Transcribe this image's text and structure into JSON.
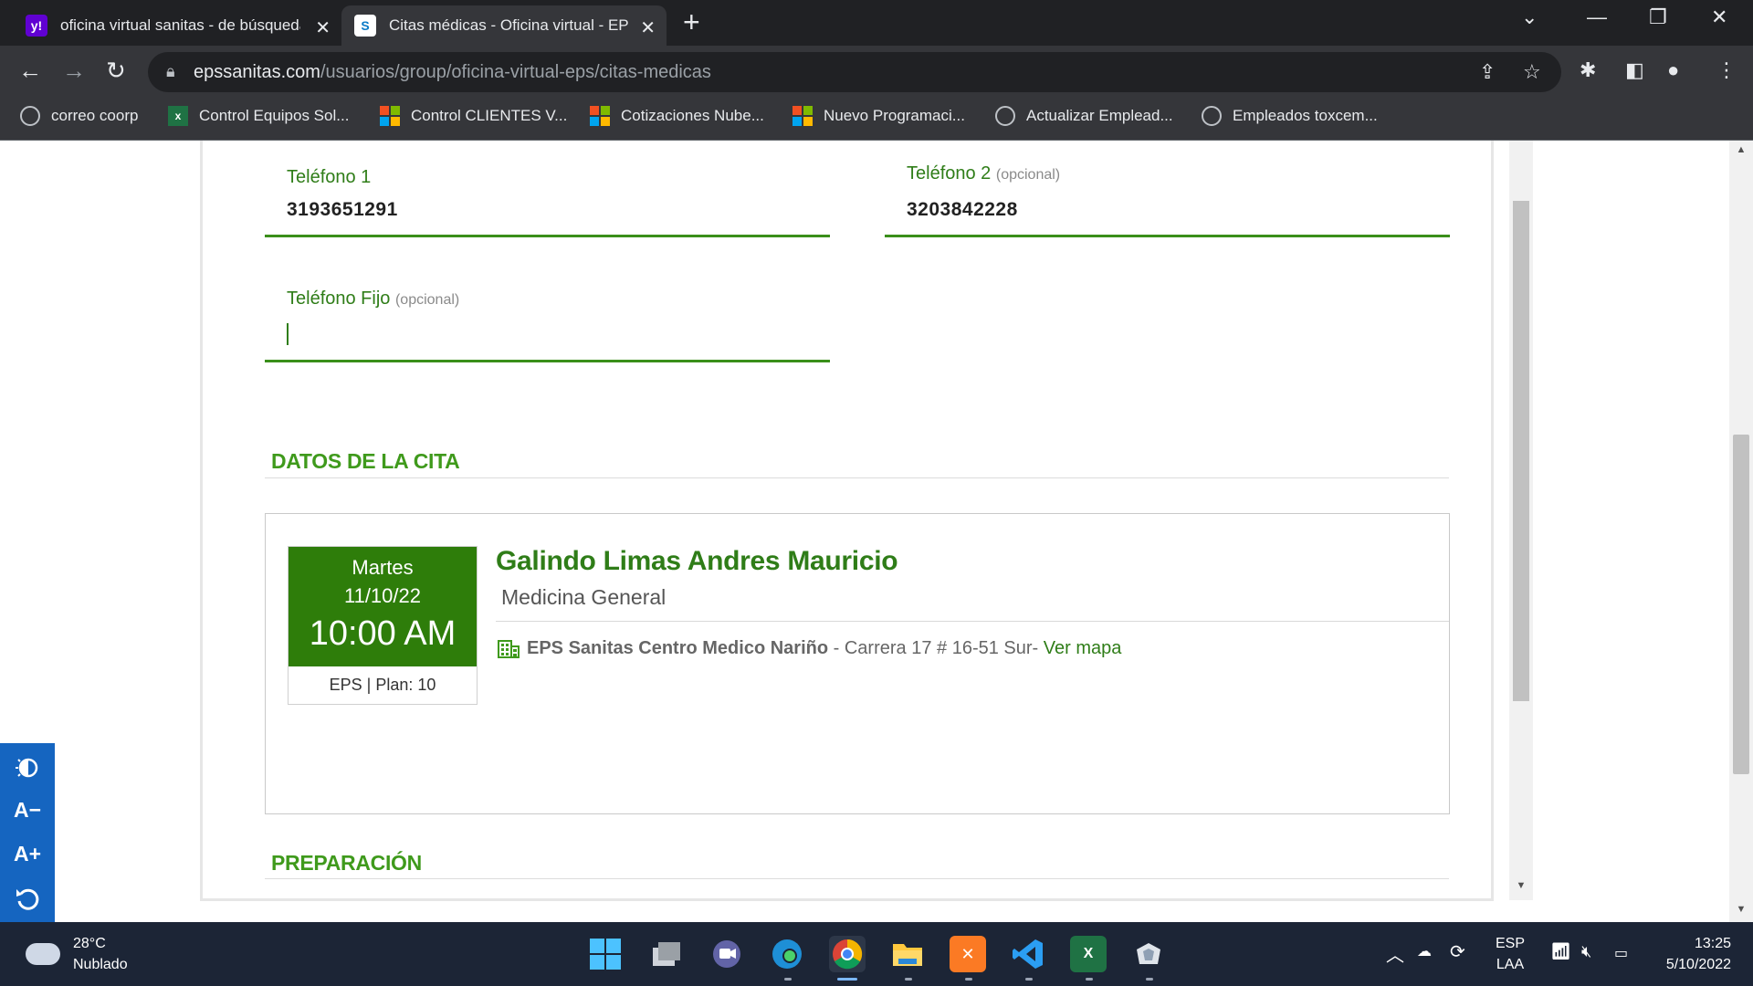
{
  "browser": {
    "tabs": [
      {
        "title": "oficina virtual sanitas - de búsqueda",
        "favicon": "yahoo-icon",
        "active": false
      },
      {
        "title": "Citas médicas - Oficina virtual - EPS",
        "favicon": "sanitas-icon",
        "active": true
      }
    ],
    "new_tab": "+",
    "url_host": "epssanitas.com",
    "url_path": "/usuarios/group/oficina-virtual-eps/citas-medicas"
  },
  "bookmarks": [
    {
      "label": "correo coorp",
      "icon": "globe-icon"
    },
    {
      "label": "Control Equipos Sol...",
      "icon": "excel-icon"
    },
    {
      "label": "Control CLIENTES V...",
      "icon": "microsoft-icon"
    },
    {
      "label": "Cotizaciones Nube...",
      "icon": "microsoft-icon"
    },
    {
      "label": "Nuevo Programaci...",
      "icon": "microsoft-icon"
    },
    {
      "label": "Actualizar Emplead...",
      "icon": "globe-icon"
    },
    {
      "label": "Empleados toxcem...",
      "icon": "globe-icon"
    }
  ],
  "form": {
    "telefono1_label": "Teléfono 1",
    "telefono1_value": "3193651291",
    "telefono2_label": "Teléfono 2",
    "telefono2_optional": "(opcional)",
    "telefono2_value": "3203842228",
    "fijo_label": "Teléfono Fijo",
    "fijo_optional": "(opcional)",
    "fijo_value": ""
  },
  "cita": {
    "section_title": "DATOS DE LA CITA",
    "day": "Martes",
    "date": "11/10/22",
    "time": "10:00 AM",
    "plan": "EPS | Plan: 10",
    "doctor": "Galindo Limas Andres Mauricio",
    "specialty": "Medicina General",
    "location_name": "EPS Sanitas Centro Medico Nariño",
    "location_sep": " - ",
    "address": "Carrera 17 # 16-51 Sur- ",
    "map_link": "Ver mapa"
  },
  "preparacion_title": "PREPARACIÓN",
  "a11y": {
    "contrast": "contrast-icon",
    "decrease": "A−",
    "increase": "A+",
    "reset": "reset-icon"
  },
  "taskbar": {
    "temperature": "28°C",
    "weather": "Nublado",
    "language": "ESP",
    "layout": "LAA",
    "time": "13:25",
    "date": "5/10/2022"
  },
  "colors": {
    "brand_green": "#2f7d18",
    "date_box_green": "#2e7d0a",
    "a11y_blue": "#1565c0"
  }
}
